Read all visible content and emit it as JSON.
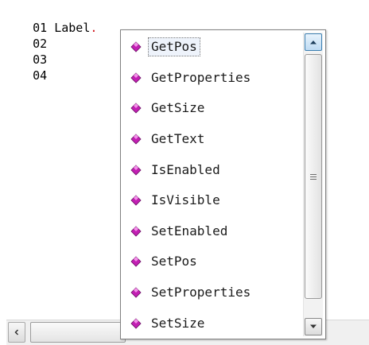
{
  "editor": {
    "lines": [
      {
        "num": "01",
        "text": "Label",
        "suffix": "."
      },
      {
        "num": "02",
        "text": "",
        "suffix": ""
      },
      {
        "num": "03",
        "text": "",
        "suffix": ""
      },
      {
        "num": "04",
        "text": "",
        "suffix": ""
      }
    ]
  },
  "completion": {
    "selected_index": 0,
    "items": [
      {
        "label": "GetPos",
        "icon": "method-gem-icon"
      },
      {
        "label": "GetProperties",
        "icon": "method-gem-icon"
      },
      {
        "label": "GetSize",
        "icon": "method-gem-icon"
      },
      {
        "label": "GetText",
        "icon": "method-gem-icon"
      },
      {
        "label": "IsEnabled",
        "icon": "method-gem-icon"
      },
      {
        "label": "IsVisible",
        "icon": "method-gem-icon"
      },
      {
        "label": "SetEnabled",
        "icon": "method-gem-icon"
      },
      {
        "label": "SetPos",
        "icon": "method-gem-icon"
      },
      {
        "label": "SetProperties",
        "icon": "method-gem-icon"
      },
      {
        "label": "SetSize",
        "icon": "method-gem-icon"
      }
    ]
  },
  "colors": {
    "gem_fill": "#c21fb3",
    "gem_highlight": "#f58fea",
    "dot_color": "#d0141b"
  }
}
